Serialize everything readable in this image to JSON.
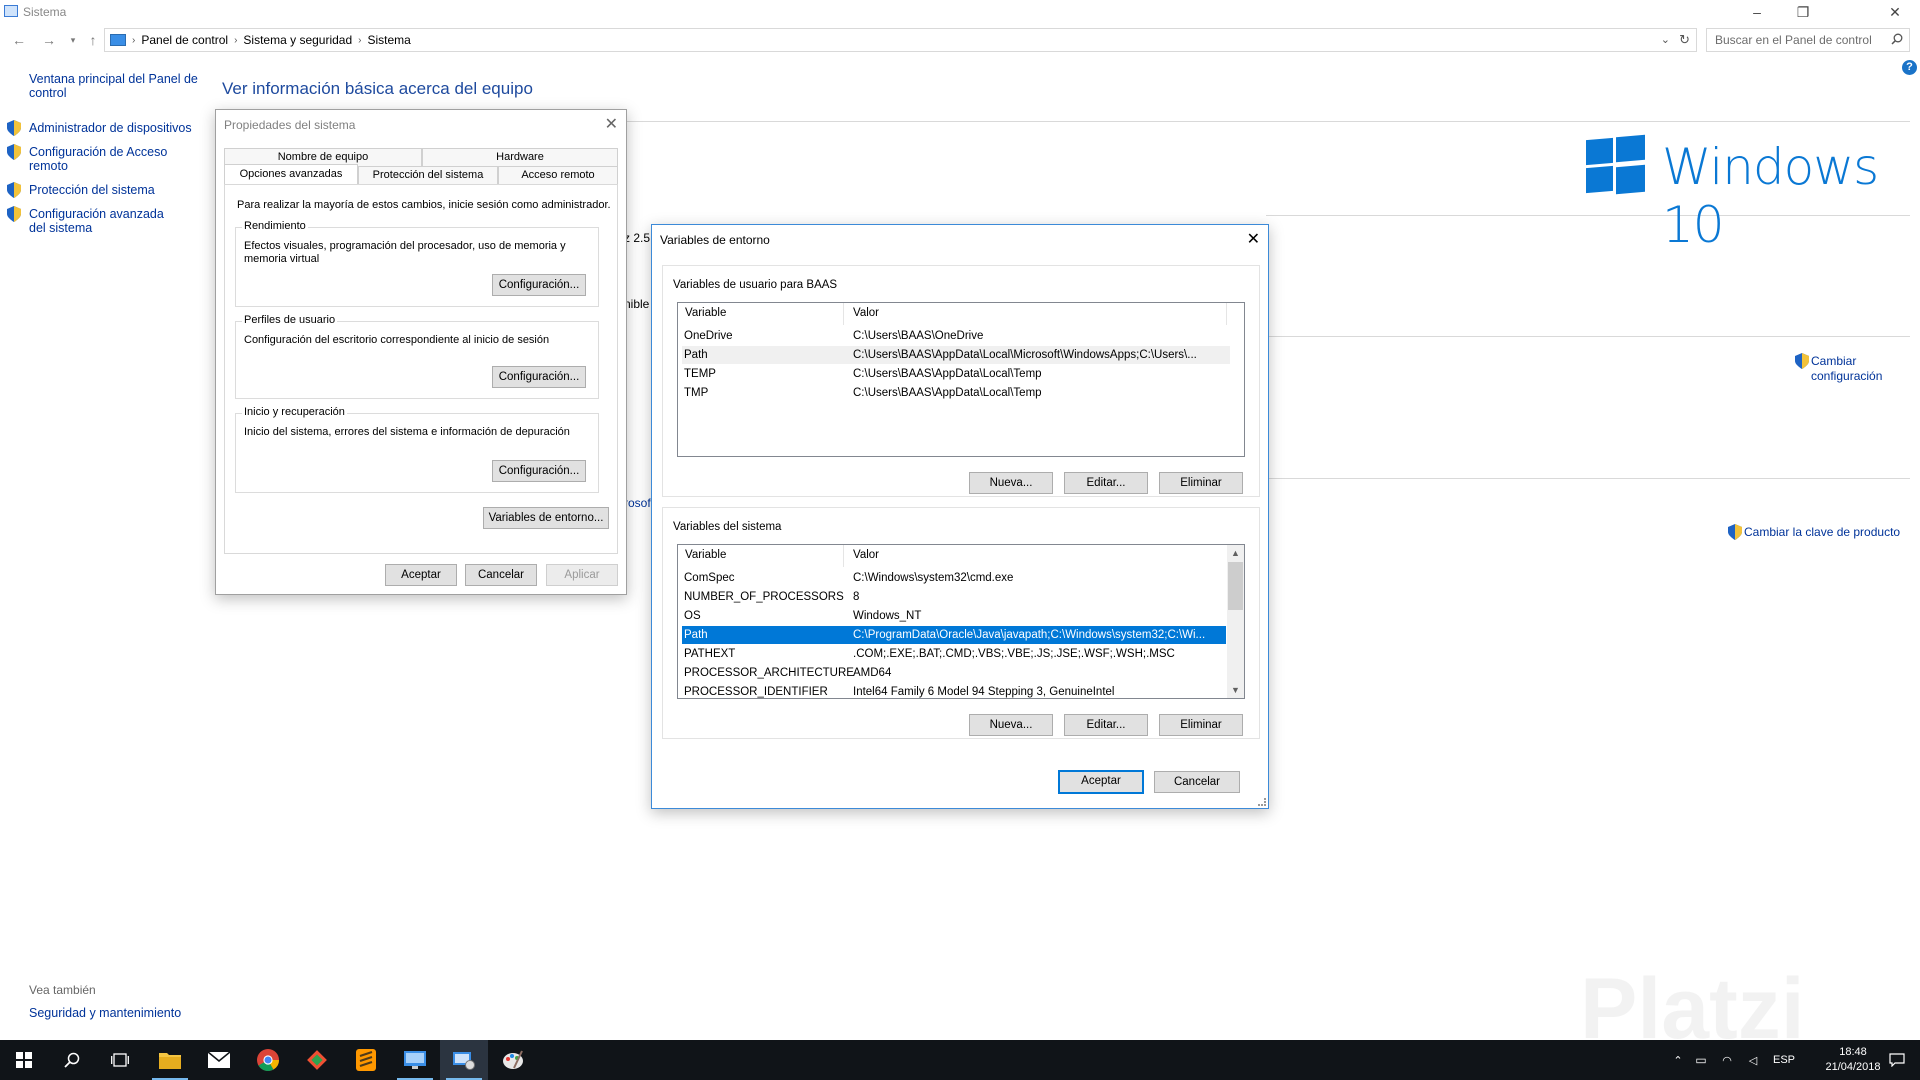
{
  "window": {
    "title": "Sistema",
    "search_placeholder": "Buscar en el Panel de control",
    "breadcrumb": [
      "Panel de control",
      "Sistema y seguridad",
      "Sistema"
    ]
  },
  "leftpanel": {
    "home": "Ventana principal del Panel de control",
    "items": [
      "Administrador de dispositivos",
      "Configuración de Acceso remoto",
      "Protección del sistema",
      "Configuración avanzada del sistema"
    ],
    "see_also": "Vea también",
    "see_also_link": "Seguridad y mantenimiento"
  },
  "content": {
    "title": "Ver información básica acerca del equipo",
    "windows_brand": "Windows 10",
    "change_config": "Cambiar configuración",
    "change_key": "Cambiar la clave de producto",
    "partial_1": "z  2.5",
    "partial_2": "nible",
    "partial_3": "rosof"
  },
  "sysprops": {
    "title": "Propiedades del sistema",
    "tabs_top": [
      "Nombre de equipo",
      "Hardware"
    ],
    "tabs_bottom": [
      "Opciones avanzadas",
      "Protección del sistema",
      "Acceso remoto"
    ],
    "admin_note": "Para realizar la mayoría de estos cambios, inicie sesión como administrador.",
    "groups": [
      {
        "label": "Rendimiento",
        "text": "Efectos visuales, programación del procesador, uso de memoria y memoria virtual",
        "button": "Configuración..."
      },
      {
        "label": "Perfiles de usuario",
        "text": "Configuración del escritorio correspondiente al inicio de sesión",
        "button": "Configuración..."
      },
      {
        "label": "Inicio y recuperación",
        "text": "Inicio del sistema, errores del sistema e información de depuración",
        "button": "Configuración..."
      }
    ],
    "env_button": "Variables de entorno...",
    "ok": "Aceptar",
    "cancel": "Cancelar",
    "apply": "Aplicar"
  },
  "envvars": {
    "title": "Variables de entorno",
    "user_section": "Variables de usuario para BAAS",
    "system_section": "Variables del sistema",
    "col_variable": "Variable",
    "col_value": "Valor",
    "user_rows": [
      {
        "name": "OneDrive",
        "value": "C:\\Users\\BAAS\\OneDrive"
      },
      {
        "name": "Path",
        "value": "C:\\Users\\BAAS\\AppData\\Local\\Microsoft\\WindowsApps;C:\\Users\\..."
      },
      {
        "name": "TEMP",
        "value": "C:\\Users\\BAAS\\AppData\\Local\\Temp"
      },
      {
        "name": "TMP",
        "value": "C:\\Users\\BAAS\\AppData\\Local\\Temp"
      }
    ],
    "system_rows": [
      {
        "name": "ComSpec",
        "value": "C:\\Windows\\system32\\cmd.exe"
      },
      {
        "name": "NUMBER_OF_PROCESSORS",
        "value": "8"
      },
      {
        "name": "OS",
        "value": "Windows_NT"
      },
      {
        "name": "Path",
        "value": "C:\\ProgramData\\Oracle\\Java\\javapath;C:\\Windows\\system32;C:\\Wi..."
      },
      {
        "name": "PATHEXT",
        "value": ".COM;.EXE;.BAT;.CMD;.VBS;.VBE;.JS;.JSE;.WSF;.WSH;.MSC"
      },
      {
        "name": "PROCESSOR_ARCHITECTURE",
        "value": "AMD64"
      },
      {
        "name": "PROCESSOR_IDENTIFIER",
        "value": "Intel64 Family 6 Model 94 Stepping 3, GenuineIntel"
      }
    ],
    "new": "Nueva...",
    "edit": "Editar...",
    "delete": "Eliminar",
    "ok": "Aceptar",
    "cancel": "Cancelar"
  },
  "taskbar": {
    "language": "ESP",
    "time": "18:48",
    "date": "21/04/2018"
  },
  "watermark": "Platzi",
  "colors": {
    "accent": "#0078d7",
    "link": "#003399",
    "windows_blue": "#0a78d4",
    "taskbar": "#101418"
  }
}
